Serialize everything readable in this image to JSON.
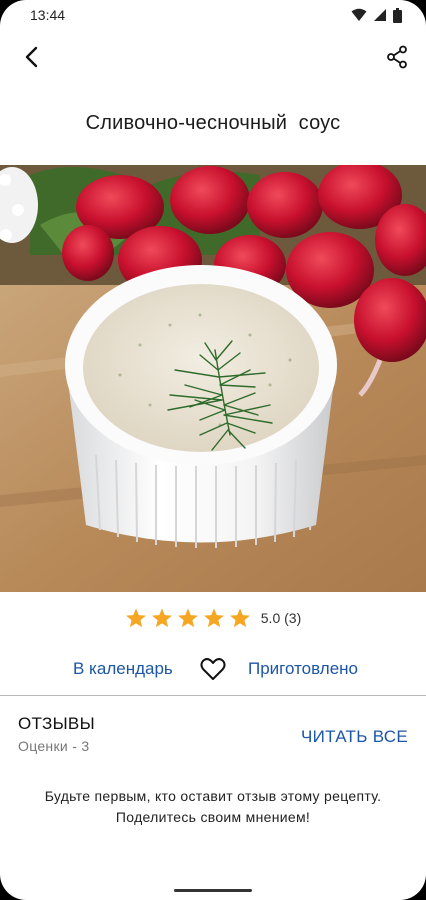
{
  "status_bar": {
    "time": "13:44"
  },
  "recipe": {
    "title": "Сливочно-чесночный  соус"
  },
  "rating": {
    "stars": 5,
    "text": "5.0 (3)"
  },
  "actions": {
    "calendar_label": "В календарь",
    "cooked_label": "Приготовлено"
  },
  "reviews": {
    "title": "ОТЗЫВЫ",
    "subtitle": "Оценки - 3",
    "read_all_label": "ЧИТАТЬ ВСЕ",
    "empty_message": "Будьте первым, кто оставит отзыв этому рецепту. Поделитесь своим мнением!"
  },
  "colors": {
    "accent": "#1d56a6",
    "star": "#f5a623"
  }
}
